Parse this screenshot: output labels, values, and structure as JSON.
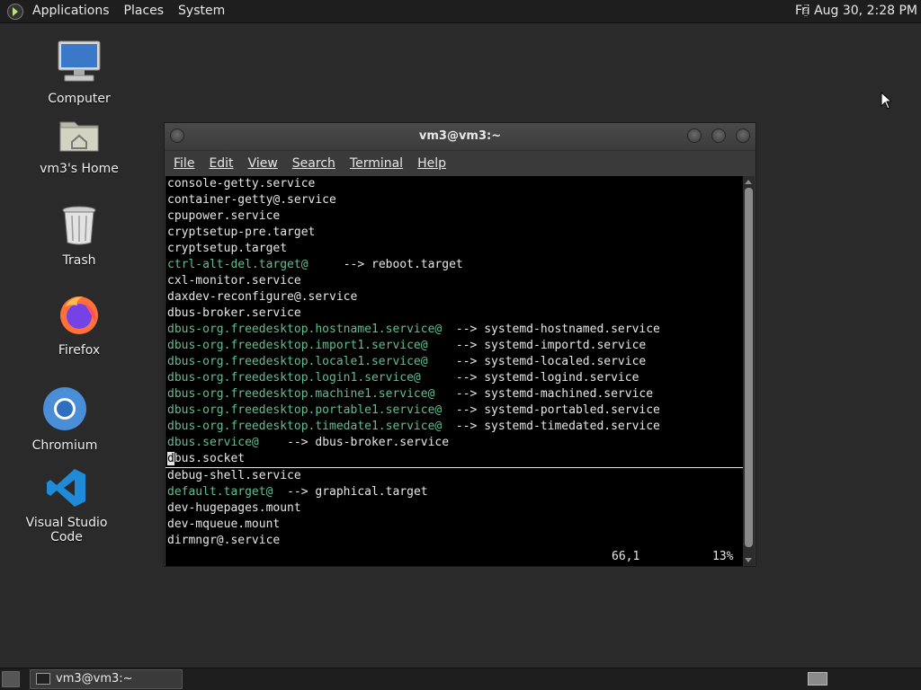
{
  "top_panel": {
    "menus": [
      "Applications",
      "Places",
      "System"
    ],
    "clock": "Fri Aug 30,  2:28 PM"
  },
  "desktop_icons": [
    {
      "label": "Computer",
      "icon": "computer-icon"
    },
    {
      "label": "vm3's Home",
      "icon": "home-folder-icon"
    },
    {
      "label": "Trash",
      "icon": "trash-icon"
    },
    {
      "label": "Firefox",
      "icon": "firefox-icon"
    },
    {
      "label": "Chromium",
      "icon": "chromium-icon"
    },
    {
      "label": "Visual Studio Code",
      "icon": "vscode-icon"
    }
  ],
  "terminal": {
    "title": "vm3@vm3:~",
    "menu": [
      "File",
      "Edit",
      "View",
      "Search",
      "Terminal",
      "Help"
    ],
    "lines": [
      {
        "text": "console-getty.service",
        "target": ""
      },
      {
        "text": "container-getty@.service",
        "target": ""
      },
      {
        "text": "cpupower.service",
        "target": ""
      },
      {
        "text": "cryptsetup-pre.target",
        "target": ""
      },
      {
        "text": "cryptsetup.target",
        "target": ""
      },
      {
        "text": "ctrl-alt-del.target@",
        "link": true,
        "pad": "     ",
        "target": "--> reboot.target"
      },
      {
        "text": "cxl-monitor.service",
        "target": ""
      },
      {
        "text": "daxdev-reconfigure@.service",
        "target": ""
      },
      {
        "text": "dbus-broker.service",
        "target": ""
      },
      {
        "text": "dbus-org.freedesktop.hostname1.service@",
        "link": true,
        "pad": "  ",
        "target": "--> systemd-hostnamed.service"
      },
      {
        "text": "dbus-org.freedesktop.import1.service@",
        "link": true,
        "pad": "    ",
        "target": "--> systemd-importd.service"
      },
      {
        "text": "dbus-org.freedesktop.locale1.service@",
        "link": true,
        "pad": "    ",
        "target": "--> systemd-localed.service"
      },
      {
        "text": "dbus-org.freedesktop.login1.service@",
        "link": true,
        "pad": "     ",
        "target": "--> systemd-logind.service"
      },
      {
        "text": "dbus-org.freedesktop.machine1.service@",
        "link": true,
        "pad": "   ",
        "target": "--> systemd-machined.service"
      },
      {
        "text": "dbus-org.freedesktop.portable1.service@",
        "link": true,
        "pad": "  ",
        "target": "--> systemd-portabled.service"
      },
      {
        "text": "dbus-org.freedesktop.timedate1.service@",
        "link": true,
        "pad": "  ",
        "target": "--> systemd-timedated.service"
      },
      {
        "text": "dbus.service@",
        "link": true,
        "pad": "    ",
        "target": "--> dbus-broker.service"
      },
      {
        "text": "dbus.socket",
        "cursor": true,
        "target": ""
      },
      {
        "text": "debug-shell.service",
        "target": ""
      },
      {
        "text": "default.target@",
        "link": true,
        "pad": "  ",
        "target": "--> graphical.target"
      },
      {
        "text": "dev-hugepages.mount",
        "target": ""
      },
      {
        "text": "dev-mqueue.mount",
        "target": ""
      },
      {
        "text": "dirmngr@.service",
        "target": ""
      }
    ],
    "status_position": "66,1",
    "status_percent": "13%",
    "scroll_fraction": 0.13
  },
  "taskbar": {
    "window_button": "vm3@vm3:~"
  },
  "colors": {
    "symlink": "#5fbf8f",
    "terminal_bg": "#000000",
    "desktop_bg": "#2a2a2a"
  }
}
